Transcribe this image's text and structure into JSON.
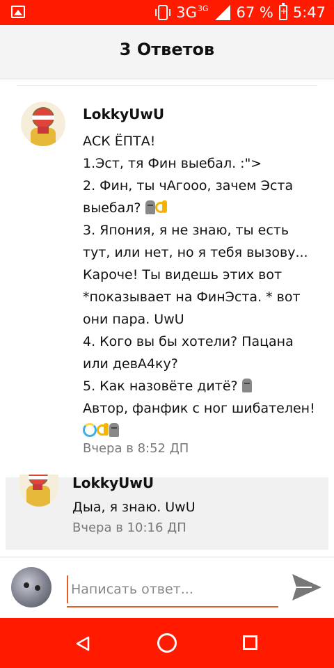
{
  "status_bar": {
    "network": "3G",
    "network_sup": "3G",
    "battery_percent": "67 %",
    "time": "5:47",
    "icons": [
      "gallery-icon",
      "vibrate-icon",
      "signal-icon",
      "battery-charging-icon"
    ]
  },
  "header": {
    "title": "3 Ответов"
  },
  "comment": {
    "author": "LokkyUwU",
    "lines": [
      "АСК ЁПТА!",
      "1.Эст, тя Фин выебал. :\">",
      "2. Фин, ты чАгооо, зачем Эста",
      "выебал?",
      "3. Япония, я не знаю, ты есть",
      "тут, или нет, но я тебя вызову...",
      "Кароче! Ты видешь этих вот",
      "*показывает на ФинЭста. * вот",
      "они пара. UwU",
      "4. Кого вы бы хотели? Пацана",
      "или девА4ку?",
      "5. Как назовёте дитё?",
      "Автор, фанфик с ног шибателен!"
    ],
    "emojis": [
      "moai-icon",
      "ok-hand-icon",
      "dizzy-icon"
    ],
    "time": "Вчера в 8:52 ДП"
  },
  "reply": {
    "author": "LokkyUwU",
    "text": "Дыа, я знаю. UwU",
    "time": "Вчера в 10:16 ДП"
  },
  "composer": {
    "placeholder": "Написать ответ...",
    "send_icon": "send-icon"
  },
  "nav_bar": {
    "icons": [
      "back-icon",
      "home-icon",
      "recents-icon"
    ]
  },
  "colors": {
    "accent": "#ff1a00",
    "input_underline": "#e85a1f",
    "meta_text": "#777777"
  }
}
